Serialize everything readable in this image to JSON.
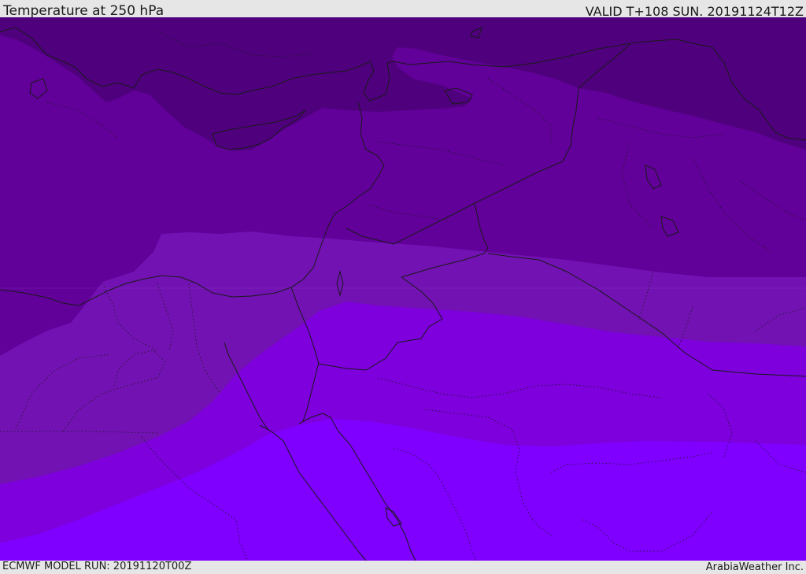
{
  "header": {
    "title": "Temperature at 250 hPa",
    "valid": "VALID T+108 SUN. 20191124T12Z"
  },
  "footer": {
    "model_run": "ECMWF MODEL RUN: 20191120T00Z",
    "credit": "ArabiaWeather Inc."
  },
  "map": {
    "variable": "temperature",
    "level": "250 hPa",
    "colors": {
      "band_coldest": "#4f007d",
      "band_cold": "#62009a",
      "band_mid": "#7212b2",
      "band_warm": "#7d00dd",
      "band_warmest": "#7f00ff",
      "coastline": "#1a1a1a",
      "border": "#1a1a1a"
    }
  }
}
